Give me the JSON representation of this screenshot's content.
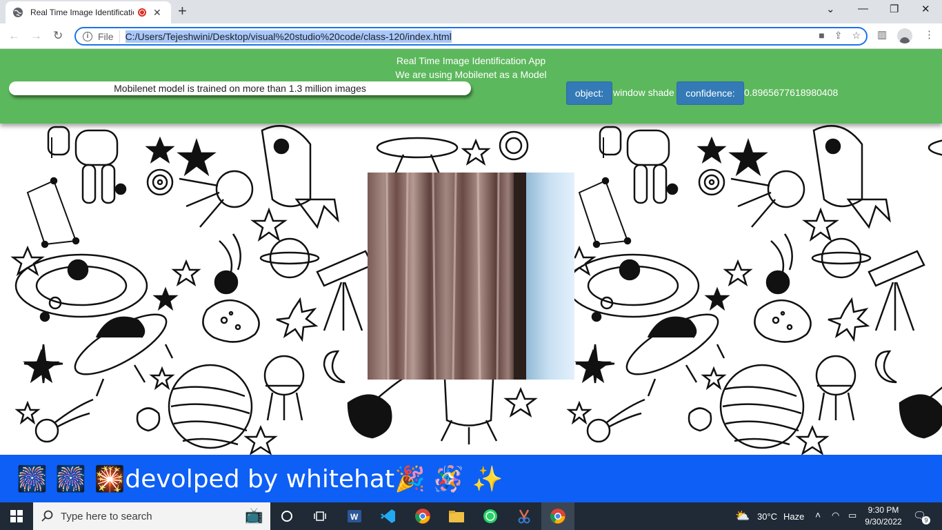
{
  "browser": {
    "tab_title": "Real Time Image Identificatio",
    "tab_close": "✕",
    "new_tab": "+",
    "address_scheme": "File",
    "url": "C:/Users/Tejeshwini/Desktop/visual%20studio%20code/class-120/index.html"
  },
  "app": {
    "title": "Real Time Image Identification App",
    "subtitle": "We are using Mobilenet as a Model",
    "model_info": "Mobilenet model is trained on more than 1.3 million images",
    "object_label": "object:",
    "object_value": "window shade",
    "confidence_label": "confidence:",
    "confidence_value": "0.8965677618980408"
  },
  "footer": {
    "text": "🎆 🎆 🎇devolped by whitehat🎉 🪅 ✨"
  },
  "taskbar": {
    "search_placeholder": "Type here to search",
    "weather_temp": "30°C",
    "weather_desc": "Haze",
    "time": "9:30 PM",
    "date": "9/30/2022",
    "notification_count": "9"
  },
  "colors": {
    "header_green": "#5cb85c",
    "badge_blue": "#337ab7",
    "footer_blue": "#0d5ff5",
    "taskbar": "#1f2a36"
  },
  "icons": [
    "globe-icon",
    "record-icon",
    "back-icon",
    "forward-icon",
    "reload-icon",
    "info-icon",
    "camera-icon",
    "share-icon",
    "star-icon",
    "sidebar-icon",
    "profile-icon",
    "menu-icon",
    "windows-icon",
    "search-icon",
    "cortana-icon",
    "task-view-icon",
    "word-icon",
    "vscode-icon",
    "chrome-icon",
    "folder-icon",
    "whatsapp-icon",
    "snipping-icon",
    "weather-icon"
  ]
}
